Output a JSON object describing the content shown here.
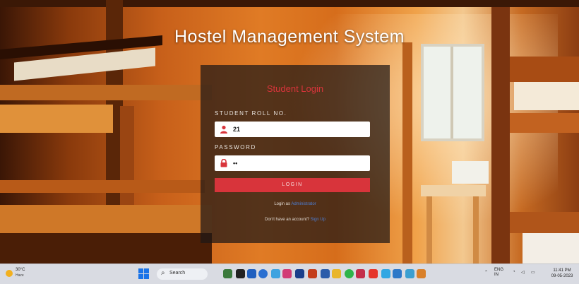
{
  "app": {
    "title": "Hostel Management System"
  },
  "login": {
    "heading": "Student Login",
    "roll_label": "STUDENT ROLL NO.",
    "roll_value": "21",
    "password_label": "PASSWORD",
    "password_value": "••",
    "button_label": "LOGIN",
    "login_as_text": "Login as",
    "login_as_link": "Administrator",
    "signup_text": "Don't have an account?",
    "signup_link": "Sign Up"
  },
  "taskbar": {
    "weather_temp": "30°C",
    "weather_desc": "Haze",
    "search_label": "Search",
    "tray_lang_1": "ENG",
    "tray_lang_2": "IN",
    "time": "11:41 PM",
    "date": "09-05-2023"
  },
  "icons": {
    "roll_icon": "user-icon",
    "password_icon": "lock-icon"
  },
  "colors": {
    "accent_red": "#d8343b",
    "link_blue": "#4d7fd6",
    "taskbar": "#d9dbe2"
  }
}
